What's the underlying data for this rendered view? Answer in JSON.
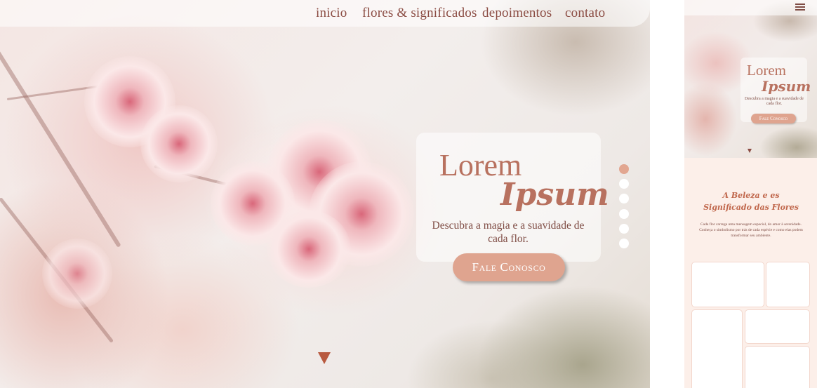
{
  "desktop": {
    "nav": {
      "items": [
        "inicio",
        "flores & significados",
        "depoimentos",
        "contato"
      ]
    },
    "hero": {
      "title_line1": "Lorem",
      "title_line2": "Ipsum",
      "subtitle": "Descubra a magia e a suavidade de cada flor.",
      "cta_label": "Fale Conosco"
    },
    "carousel": {
      "slide_count": 6,
      "active_index": 0
    },
    "colors": {
      "accent": "#dfa48f",
      "text": "#8b4c43",
      "heading": "#b8715f"
    }
  },
  "mobile": {
    "menu_icon": "hamburger-icon",
    "hero": {
      "title_line1": "Lorem",
      "title_line2": "Ipsum",
      "subtitle": "Descubra a magia e a suavidade de cada flor.",
      "cta_label": "Fale Conosco"
    },
    "section": {
      "title": "A Beleza e es Significado das Flores",
      "text": "Cada flor carrega uma mensagem especial, do amor à serenidade. Conheça o simbolismo por trás de cada espécie e como elas podem transformar seu ambiente."
    }
  }
}
